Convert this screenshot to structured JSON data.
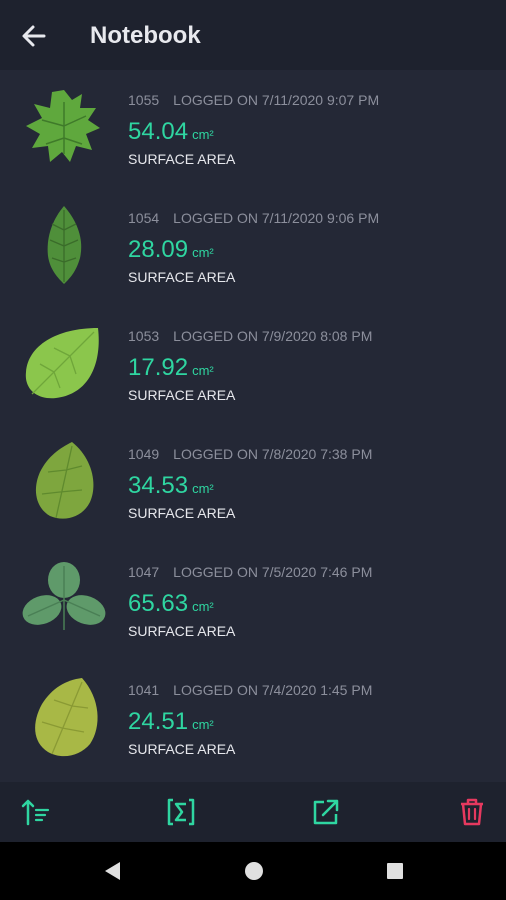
{
  "app_bar": {
    "title": "Notebook",
    "back_icon": "arrow-left-icon"
  },
  "colors": {
    "background": "#242836",
    "bar": "#1e222e",
    "accent": "#2fd6a1",
    "delete": "#e6395f",
    "meta_text": "#8c8f9c",
    "label_text": "#e6e7ec"
  },
  "entries": [
    {
      "id": "1055",
      "logged": "LOGGED ON 7/11/2020 9:07 PM",
      "value": "54.04",
      "unit": "cm²",
      "label": "SURFACE AREA",
      "leaf_icon": "maple-leaf-icon"
    },
    {
      "id": "1054",
      "logged": "LOGGED ON 7/11/2020 9:06 PM",
      "value": "28.09",
      "unit": "cm²",
      "label": "SURFACE AREA",
      "leaf_icon": "serrated-leaf-icon"
    },
    {
      "id": "1053",
      "logged": "LOGGED ON 7/9/2020 8:08 PM",
      "value": "17.92",
      "unit": "cm²",
      "label": "SURFACE AREA",
      "leaf_icon": "round-leaf-icon"
    },
    {
      "id": "1049",
      "logged": "LOGGED ON 7/8/2020 7:38 PM",
      "value": "34.53",
      "unit": "cm²",
      "label": "SURFACE AREA",
      "leaf_icon": "oval-leaf-icon"
    },
    {
      "id": "1047",
      "logged": "LOGGED ON 7/5/2020 7:46 PM",
      "value": "65.63",
      "unit": "cm²",
      "label": "SURFACE AREA",
      "leaf_icon": "clover-leaf-icon"
    },
    {
      "id": "1041",
      "logged": "LOGGED ON 7/4/2020 1:45 PM",
      "value": "24.51",
      "unit": "cm²",
      "label": "SURFACE AREA",
      "leaf_icon": "yellow-leaf-icon"
    }
  ],
  "bottom_bar": {
    "sort_icon": "sort-icon",
    "sum_icon": "sigma-icon",
    "export_icon": "export-icon",
    "delete_icon": "trash-icon"
  },
  "system_nav": {
    "back_icon": "triangle-back-icon",
    "home_icon": "circle-home-icon",
    "recents_icon": "square-recents-icon"
  }
}
